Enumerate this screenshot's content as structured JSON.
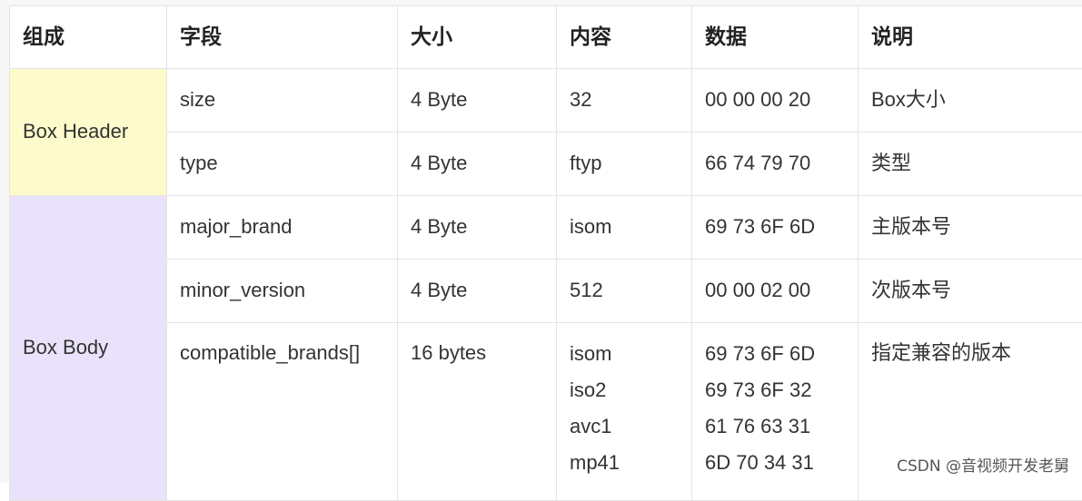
{
  "table": {
    "headers": [
      "组成",
      "字段",
      "大小",
      "内容",
      "数据",
      "说明"
    ],
    "groups": {
      "header": "Box Header",
      "body": "Box Body"
    },
    "rows": [
      {
        "field": "size",
        "size": "4 Byte",
        "content": "32",
        "data": "00 00 00 20",
        "desc": "Box大小"
      },
      {
        "field": "type",
        "size": "4 Byte",
        "content": "ftyp",
        "data": "66 74 79 70",
        "desc": "类型"
      },
      {
        "field": "major_brand",
        "size": "4 Byte",
        "content": "isom",
        "data": "69 73 6F 6D",
        "desc": "主版本号"
      },
      {
        "field": "minor_version",
        "size": "4 Byte",
        "content": "512",
        "data": "00 00 02 00",
        "desc": "次版本号"
      },
      {
        "field": "compatible_brands[]",
        "size": "16 bytes",
        "content": [
          "isom",
          "iso2",
          "avc1",
          "mp41"
        ],
        "data": [
          "69 73 6F 6D",
          "69 73 6F 32",
          "61 76 63 31",
          "6D 70 34 31"
        ],
        "desc": "指定兼容的版本"
      }
    ]
  },
  "watermark": "CSDN @音视频开发老舅"
}
